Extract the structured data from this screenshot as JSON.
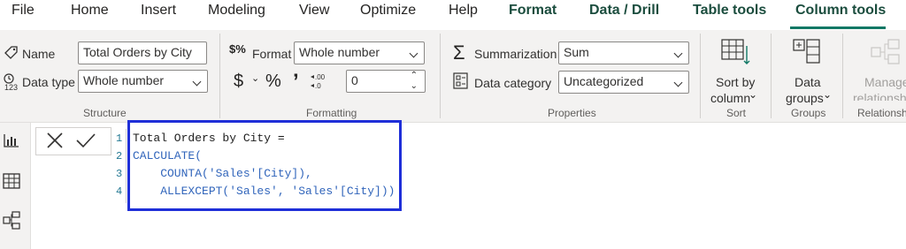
{
  "menu": {
    "items": [
      "File",
      "Home",
      "Insert",
      "Modeling",
      "View",
      "Optimize",
      "Help",
      "Format",
      "Data / Drill",
      "Table tools",
      "Column tools"
    ],
    "active": "Column tools"
  },
  "ribbon": {
    "structure": {
      "name_label": "Name",
      "name_value": "Total Orders by City",
      "datatype_label": "Data type",
      "datatype_value": "Whole number",
      "group_label": "Structure"
    },
    "formatting": {
      "format_label": "Format",
      "format_value": "Whole number",
      "currency_symbol": "$",
      "percent_symbol": "%",
      "comma_symbol": "’",
      "decimal_value": "0",
      "group_label": "Formatting"
    },
    "properties": {
      "summarization_label": "Summarization",
      "summarization_value": "Sum",
      "category_label": "Data category",
      "category_value": "Uncategorized",
      "group_label": "Properties"
    },
    "sort": {
      "button_line1": "Sort by",
      "button_line2": "column",
      "group_label": "Sort"
    },
    "groups": {
      "button_line1": "Data",
      "button_line2": "groups",
      "group_label": "Groups"
    },
    "relationships": {
      "button_line1": "Manage",
      "button_line2": "relationships",
      "group_label": "Relationships"
    }
  },
  "formula": {
    "line_numbers": [
      "1",
      "2",
      "3",
      "4"
    ],
    "lines": [
      "Total Orders by City =",
      "CALCULATE(",
      "    COUNTA('Sales'[City]),",
      "    ALLEXCEPT('Sales', 'Sales'[City]))"
    ]
  },
  "colors": {
    "accent": "#117865",
    "highlight_border": "#1f2fd8",
    "function_keyword": "#3165bb"
  },
  "icons": [
    "tag-icon",
    "data-type-123-icon",
    "format-dollar-percent-icon",
    "sigma-icon",
    "data-category-icon",
    "sort-by-column-icon",
    "data-groups-icon",
    "manage-relationships-icon",
    "report-view-icon",
    "table-view-icon",
    "model-view-icon",
    "cancel-x-icon",
    "commit-check-icon"
  ]
}
